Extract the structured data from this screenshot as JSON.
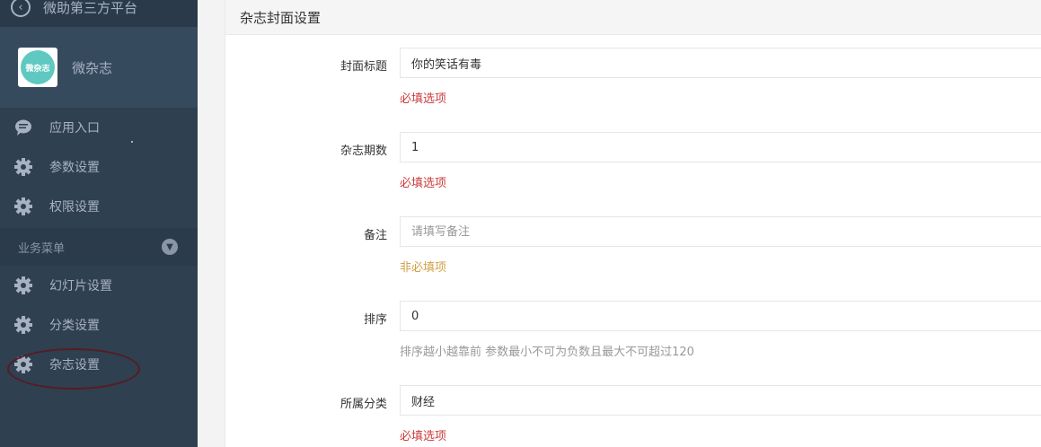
{
  "sidebar": {
    "top_title": "微助第三方平台",
    "app": {
      "logo_text": "微杂志",
      "name": "微杂志"
    },
    "menu": [
      {
        "label": "应用入口",
        "icon": "chat-bubble-icon"
      },
      {
        "label": "参数设置",
        "icon": "gear-icon"
      },
      {
        "label": "权限设置",
        "icon": "gear-icon"
      }
    ],
    "section": {
      "label": "业务菜单"
    },
    "business_menu": [
      {
        "label": "幻灯片设置",
        "icon": "gear-icon"
      },
      {
        "label": "分类设置",
        "icon": "gear-icon"
      },
      {
        "label": "杂志设置",
        "icon": "gear-icon"
      }
    ]
  },
  "panel": {
    "title": "杂志封面设置",
    "fields": [
      {
        "label": "封面标题",
        "value": "你的笑话有毒",
        "placeholder": "",
        "help": "必填选项",
        "help_type": "required"
      },
      {
        "label": "杂志期数",
        "value": "1",
        "placeholder": "",
        "help": "必填选项",
        "help_type": "required"
      },
      {
        "label": "备注",
        "value": "",
        "placeholder": "请填写备注",
        "help": "非必填项",
        "help_type": "optional"
      },
      {
        "label": "排序",
        "value": "0",
        "placeholder": "",
        "help": "排序越小越靠前 参数最小不可为负数且最大不可超过120",
        "help_type": "info"
      },
      {
        "label": "所属分类",
        "value": "财经",
        "placeholder": "",
        "help": "必填选项",
        "help_type": "required"
      }
    ]
  },
  "colors": {
    "sidebar_bg": "#2f4050",
    "required": "#cc3b3b",
    "optional": "#d2a046",
    "logo_teal": "#5ec8c1"
  }
}
